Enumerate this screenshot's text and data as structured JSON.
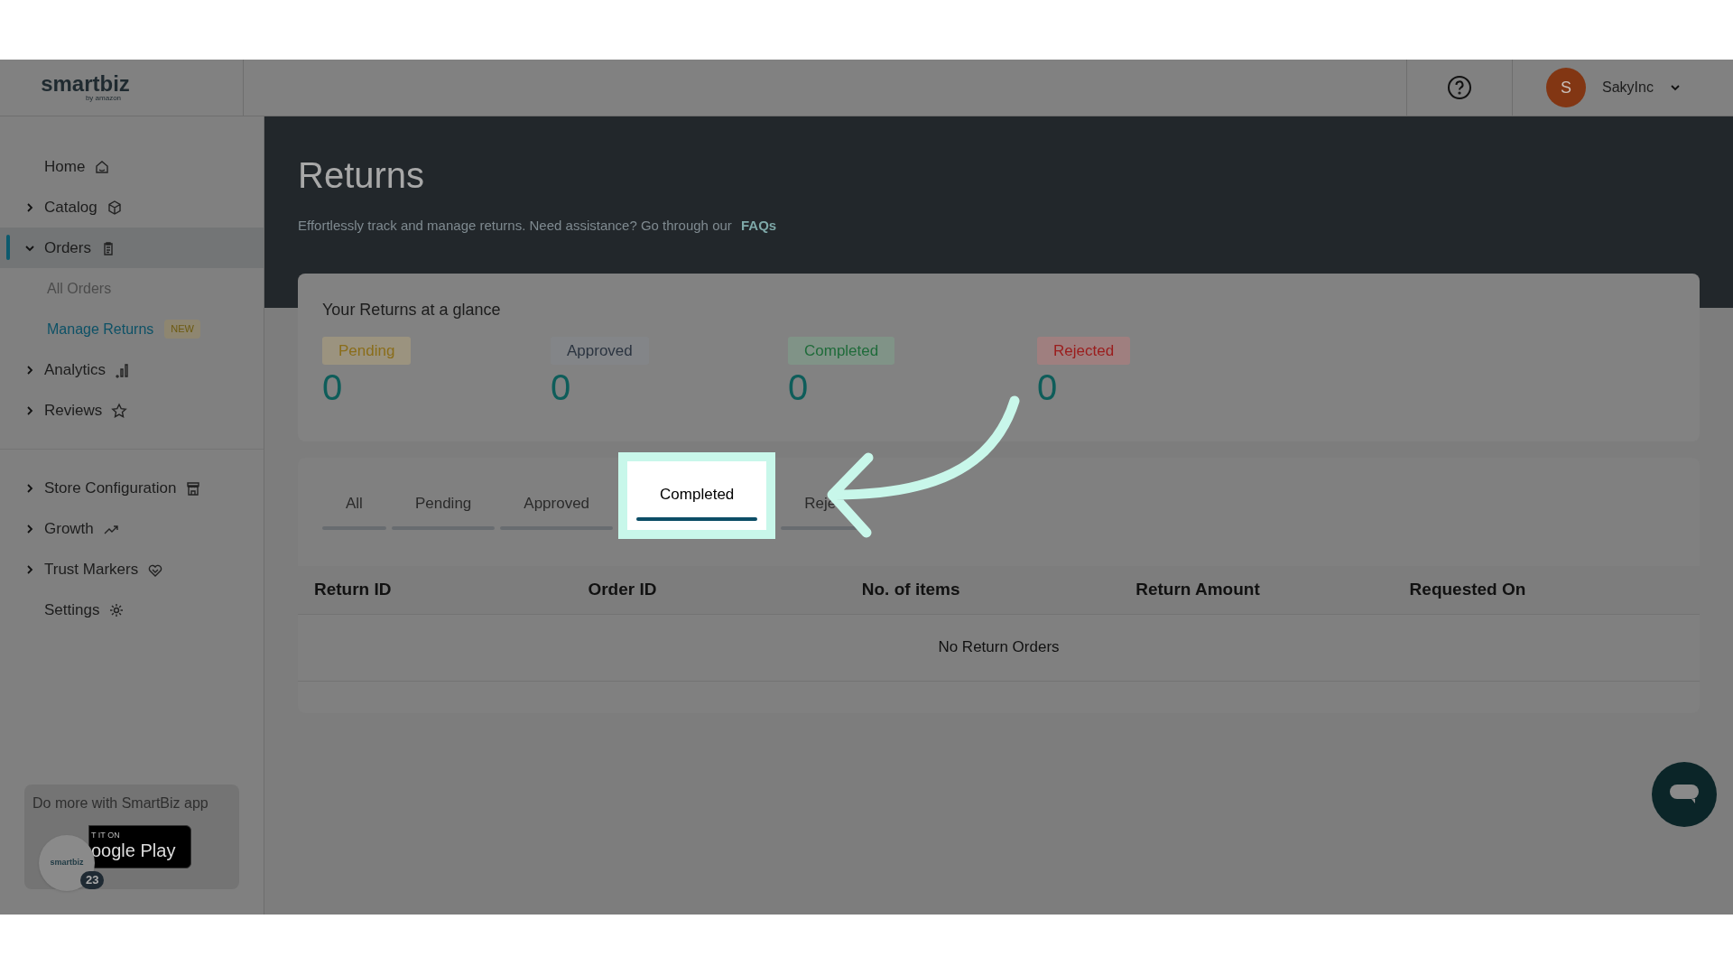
{
  "header": {
    "logo": "smartbiz",
    "logo_sub": "by amazon",
    "user": {
      "initial": "S",
      "name": "SakyInc"
    }
  },
  "sidebar": {
    "groups": [
      [
        {
          "label": "Home",
          "selected": false
        },
        {
          "label": "Catalog",
          "selected": false,
          "expanded": false
        },
        {
          "label": "Orders",
          "selected": true,
          "expanded": true,
          "children": [
            {
              "label": "All Orders",
              "selected": false
            },
            {
              "label": "Manage Returns",
              "selected": true,
              "badge": "NEW"
            }
          ]
        },
        {
          "label": "Analytics",
          "selected": false,
          "expanded": false
        },
        {
          "label": "Reviews",
          "selected": false,
          "expanded": false
        }
      ],
      [
        {
          "label": "Store Configuration",
          "selected": false,
          "expanded": false
        },
        {
          "label": "Growth",
          "selected": false,
          "expanded": false
        },
        {
          "label": "Trust Markers",
          "selected": false,
          "expanded": false
        },
        {
          "label": "Settings",
          "selected": false
        }
      ]
    ],
    "promo": {
      "text": "Do more with SmartBiz app",
      "store_line1": "T IT ON",
      "store_line2": "oogle Play",
      "bubble_logo": "smartbiz",
      "bubble_count": "23"
    }
  },
  "page": {
    "title": "Returns",
    "subtitle": "Effortlessly track and manage returns. Need assistance? Go through our",
    "link": "FAQs"
  },
  "glance": {
    "title": "Your Returns at a glance",
    "stats": [
      {
        "label": "Pending",
        "count": "0",
        "color": "#8a6d1a"
      },
      {
        "label": "Approved",
        "count": "0",
        "color": "#2b3440"
      },
      {
        "label": "Completed",
        "count": "0",
        "color": "#1f6b3a"
      },
      {
        "label": "Rejected",
        "count": "0",
        "color": "#9b1c1c"
      }
    ]
  },
  "tabs": [
    {
      "label": "All",
      "selected": false
    },
    {
      "label": "Pending",
      "selected": false
    },
    {
      "label": "Approved",
      "selected": false
    },
    {
      "label": "Completed",
      "selected": true
    },
    {
      "label": "Reje",
      "selected": false
    }
  ],
  "table": {
    "columns": [
      "Return ID",
      "Order ID",
      "No. of items",
      "Return Amount",
      "Requested On"
    ],
    "empty": "No Return Orders"
  }
}
